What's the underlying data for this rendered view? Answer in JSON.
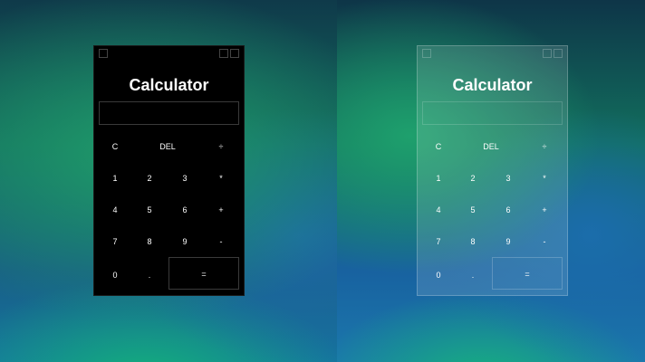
{
  "left_calculator": {
    "title": "Calculator",
    "display_value": "",
    "buttons": [
      "C",
      "DEL",
      "÷",
      "1",
      "2",
      "3",
      "*",
      "4",
      "5",
      "6",
      "+",
      "7",
      "8",
      "9",
      "-",
      "0",
      ".",
      "="
    ]
  },
  "right_calculator": {
    "title": "Calculator",
    "display_value": "",
    "buttons": [
      "C",
      "DEL",
      "÷",
      "1",
      "2",
      "3",
      "*",
      "4",
      "5",
      "6",
      "+",
      "7",
      "8",
      "9",
      "-",
      "0",
      ".",
      "="
    ]
  },
  "colors": {
    "dark_calc_bg": "#000000",
    "glass_calc_bg": "rgba(255,255,255,0.13)",
    "text": "#ffffff"
  }
}
